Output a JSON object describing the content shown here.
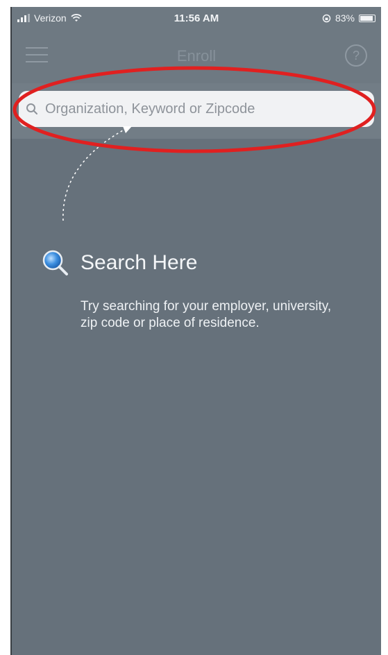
{
  "status_bar": {
    "carrier": "Verizon",
    "time": "11:56 AM",
    "battery": "83%"
  },
  "nav": {
    "title": "Enroll",
    "help_glyph": "?"
  },
  "search": {
    "placeholder": "Organization, Keyword or Zipcode",
    "value": ""
  },
  "hint": {
    "title": "Search Here",
    "text": "Try searching for your employer, university, zip code or place of residence."
  },
  "icons": {
    "menu": "hamburger-menu-icon",
    "help": "help-icon",
    "search": "search-icon",
    "hint": "magnifier-icon"
  },
  "colors": {
    "background": "#66717b",
    "annotation": "#e02020",
    "search_box": "#f1f2f4"
  }
}
